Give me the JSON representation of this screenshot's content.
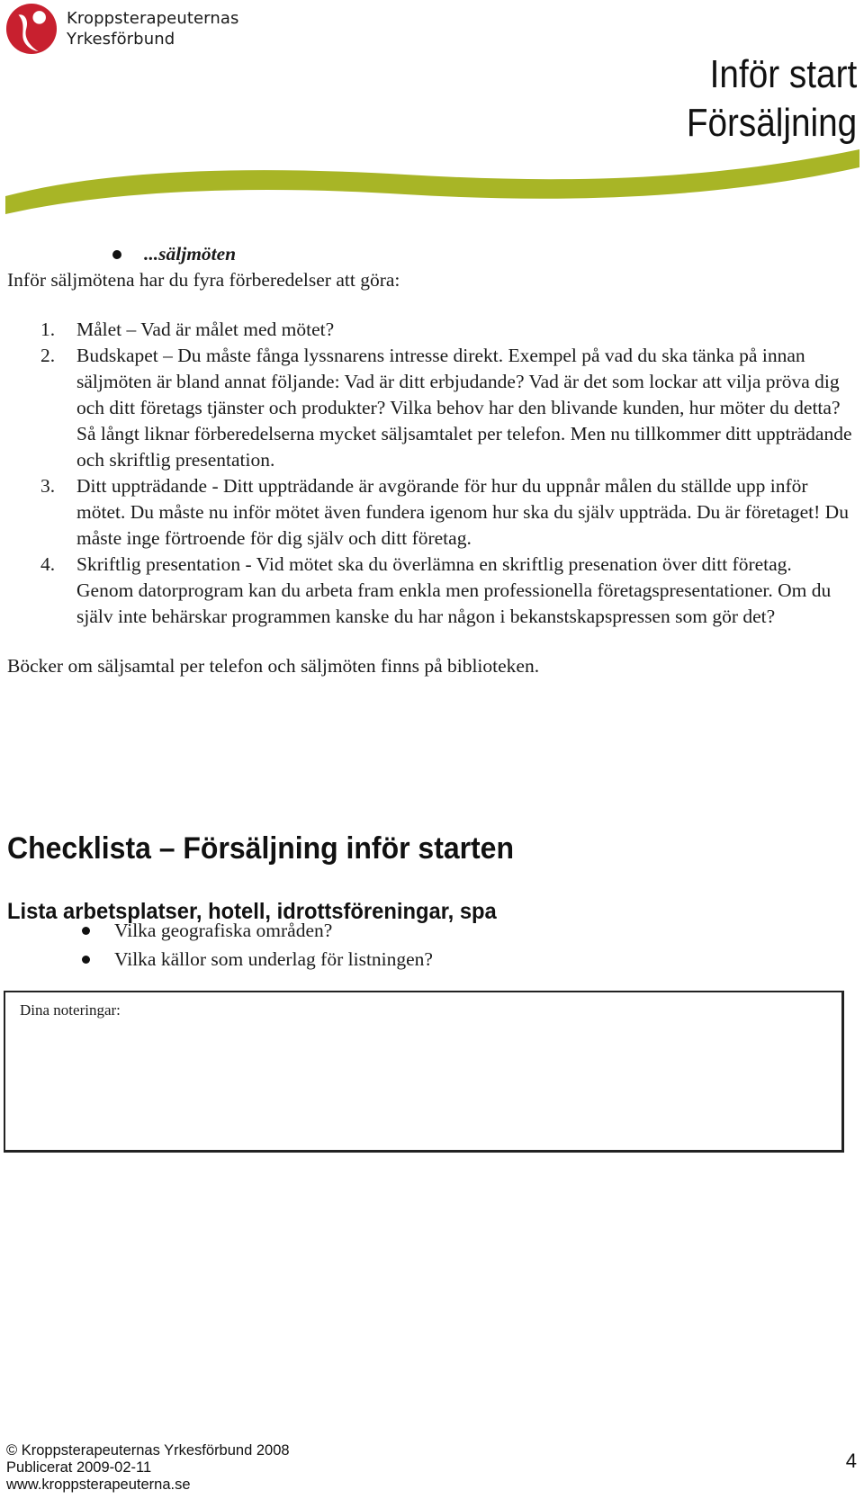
{
  "header": {
    "org_name_line1": "Kroppsterapeuternas",
    "org_name_line2": "Yrkesförbund",
    "title_line1": "Inför start",
    "title_line2": "Försäljning",
    "brand_colors": {
      "logo_red": "#c8202f",
      "swoosh_green": "#a8b526"
    }
  },
  "section": {
    "bullet_heading": "...säljmöten",
    "intro": "Inför säljmötena har du fyra förberedelser att göra:",
    "steps": [
      {
        "number": "1.",
        "text": "Målet – Vad är målet med mötet?"
      },
      {
        "number": "2.",
        "text": "Budskapet – Du måste fånga lyssnarens intresse direkt. Exempel på vad du ska tänka på innan säljmöten är bland annat följande: Vad är ditt erbjudande? Vad är det som lockar att vilja pröva dig och ditt företags tjänster och produkter? Vilka behov har den blivande kunden, hur möter du detta?",
        "extra": "Så långt liknar förberedelserna mycket säljsamtalet per telefon. Men nu tillkommer ditt uppträdande och skriftlig presentation."
      },
      {
        "number": "3.",
        "text": "Ditt uppträdande - Ditt uppträdande är avgörande för hur du uppnår målen du ställde upp inför mötet. Du måste nu inför mötet även fundera igenom hur ska du själv uppträda. Du är företaget! Du måste inge förtroende för dig själv och ditt företag."
      },
      {
        "number": "4.",
        "text": "Skriftlig presentation - Vid mötet ska du överlämna en skriftlig presenation över ditt företag. Genom datorprogram kan du arbeta fram enkla men professionella företagspresentationer. Om du själv inte behärskar programmen kanske du har någon i bekanstskapspressen som gör det?"
      }
    ],
    "closing": "Böcker om säljsamtal per telefon och säljmöten finns på biblioteken."
  },
  "checklist": {
    "title": "Checklista – Försäljning inför starten",
    "subheading": "Lista arbetsplatser, hotell, idrottsföreningar, spa",
    "questions": [
      "Vilka geografiska områden?",
      "Vilka källor som underlag för listningen?"
    ],
    "notes_label": "Dina noteringar:"
  },
  "footer": {
    "copyright": "© Kroppsterapeuternas Yrkesförbund 2008",
    "published": "Publicerat 2009-02-11",
    "website": "www.kroppsterapeuterna.se",
    "page_number": "4"
  }
}
